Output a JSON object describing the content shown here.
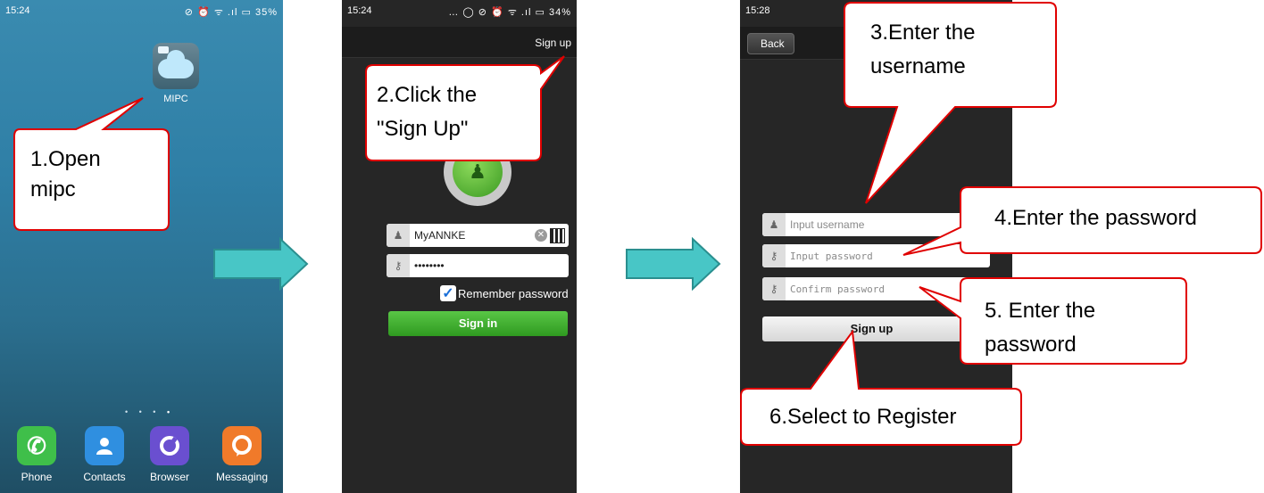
{
  "phone1": {
    "status": {
      "time": "15:24",
      "icons": "⊘ ⏰ ᯤ .ıl ▭ 35%"
    },
    "app": {
      "label": "MIPC"
    },
    "dock": [
      {
        "label": "Phone",
        "color": "#3fbf4a",
        "glyph": "✆"
      },
      {
        "label": "Contacts",
        "color": "#2f8fe0",
        "glyph": "👤"
      },
      {
        "label": "Browser",
        "color": "#6a4fd0",
        "glyph": "O"
      },
      {
        "label": "Messaging",
        "color": "#f07a2a",
        "glyph": "💬"
      }
    ]
  },
  "phone2": {
    "status": {
      "time": "15:24",
      "icons": "… ◯ ⊘ ⏰ ᯤ .ıl ▭ 34%"
    },
    "nav": {
      "signup": "Sign up"
    },
    "username": {
      "value": "MyANNKE"
    },
    "password": {
      "value": "••••••••"
    },
    "remember": "Remember password",
    "signin": "Sign in"
  },
  "phone3": {
    "status": {
      "time": "15:28"
    },
    "nav": {
      "back": "Back"
    },
    "fields": {
      "username": "Input username",
      "password": "Input password",
      "confirm": "Confirm password"
    },
    "signup": "Sign up"
  },
  "callouts": {
    "c1": [
      "1.Open",
      "mipc"
    ],
    "c2": [
      "2.Click the",
      "\"Sign Up\""
    ],
    "c3": [
      "3.Enter the",
      "username"
    ],
    "c4": [
      "4.Enter the password"
    ],
    "c5": [
      "5. Enter the",
      "password"
    ],
    "c6": [
      "6.Select to Register"
    ]
  },
  "colors": {
    "callout_border": "#e00000",
    "arrow": "#48c6c6",
    "arrow_border": "#2a8f8f"
  }
}
